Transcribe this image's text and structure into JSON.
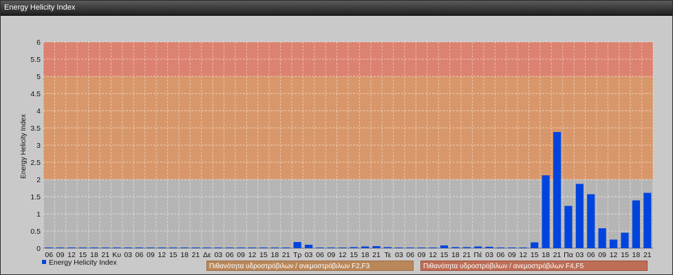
{
  "window": {
    "title": "Energy Helicity Index"
  },
  "legend": {
    "series_label": "Energy Helicity Index"
  },
  "bands": [
    {
      "label": "Πιθανότητα υδροστρόβιλων / ανεμοστρόβιλων F2,F3",
      "color": "#b9875a"
    },
    {
      "label": "Πιθανότητα υδροστρόβιλων / ανεμοστρόβιλων F4,F5",
      "color": "#bd6e56"
    }
  ],
  "chart_data": {
    "type": "bar",
    "ylabel": "Energy Helicity Index",
    "ylim": [
      0,
      6
    ],
    "yticks": [
      "0",
      "0.5",
      "1",
      "1.5",
      "2",
      "2.5",
      "3",
      "3.5",
      "4",
      "4.5",
      "5",
      "5.5",
      "6"
    ],
    "zones": [
      {
        "from": 0,
        "to": 2,
        "color": "#b5b5b5"
      },
      {
        "from": 2,
        "to": 5,
        "color": "#d8976a"
      },
      {
        "from": 5,
        "to": 6,
        "color": "#dc8270"
      }
    ],
    "bar_color": "#0044dd",
    "grid": true,
    "categories": [
      "06",
      "09",
      "12",
      "15",
      "18",
      "21",
      "Κυ",
      "03",
      "06",
      "09",
      "12",
      "15",
      "18",
      "21",
      "Δε",
      "03",
      "06",
      "09",
      "12",
      "15",
      "18",
      "21",
      "Τρ",
      "03",
      "06",
      "09",
      "12",
      "15",
      "18",
      "21",
      "Τε",
      "03",
      "06",
      "09",
      "12",
      "15",
      "18",
      "21",
      "Πέ",
      "03",
      "06",
      "09",
      "12",
      "15",
      "18",
      "21",
      "Πα",
      "03",
      "06",
      "09",
      "12",
      "15",
      "18",
      "21"
    ],
    "series": [
      {
        "name": "Energy Helicity Index",
        "values": [
          0.01,
          0.01,
          0.01,
          0.01,
          0.01,
          0.01,
          0.01,
          0.01,
          0.01,
          0.01,
          0.01,
          0.01,
          0.01,
          0.01,
          0.01,
          0.01,
          0.01,
          0.01,
          0.01,
          0.01,
          0.01,
          0.01,
          0.18,
          0.1,
          0.02,
          0.02,
          0.02,
          0.03,
          0.05,
          0.06,
          0.03,
          0.02,
          0.02,
          0.01,
          0.01,
          0.08,
          0.03,
          0.03,
          0.05,
          0.04,
          0.02,
          0.01,
          0.01,
          0.17,
          2.12,
          3.38,
          1.23,
          1.87,
          1.57,
          0.58,
          0.25,
          0.45,
          1.39,
          1.61
        ]
      }
    ]
  }
}
